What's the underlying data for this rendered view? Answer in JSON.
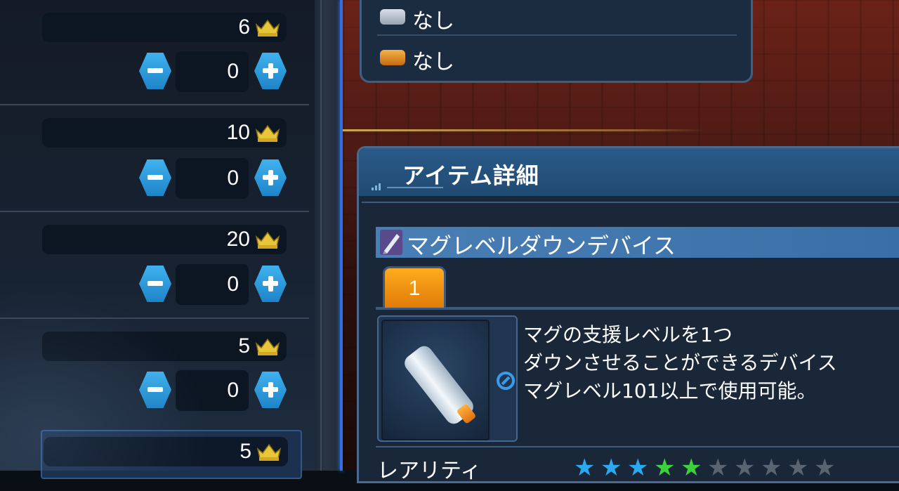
{
  "left_panel": {
    "rows": [
      {
        "cost": "6",
        "quantity": "0"
      },
      {
        "cost": "10",
        "quantity": "0"
      },
      {
        "cost": "20",
        "quantity": "0"
      },
      {
        "cost": "5",
        "quantity": "0"
      }
    ],
    "selected_row": {
      "cost": "5"
    }
  },
  "top_panel": {
    "slots": [
      {
        "label": "なし",
        "icon": "silver-ticket-icon",
        "color": "#b0b8c4"
      },
      {
        "label": "なし",
        "icon": "gold-ticket-icon",
        "color": "#e0902a"
      }
    ]
  },
  "detail": {
    "title": "アイテム詳細",
    "item_name": "マグレベルダウンデバイス",
    "tab_label": "1",
    "description": [
      "マグの支援レベルを1つ",
      "ダウンさせることができるデバイス",
      "マグレベル101以上で使用可能。"
    ],
    "rarity_label": "レアリティ",
    "rarity": {
      "filled_blue": 3,
      "filled_green": 2,
      "empty": 5,
      "colors": {
        "blue": "#2aa8f0",
        "green": "#3cd23c",
        "empty": "#5a6470"
      }
    }
  },
  "colors": {
    "accent_blue": "#2f6ee6",
    "tab_orange": "#ffab1f",
    "header_blue": "#2a5a88"
  }
}
